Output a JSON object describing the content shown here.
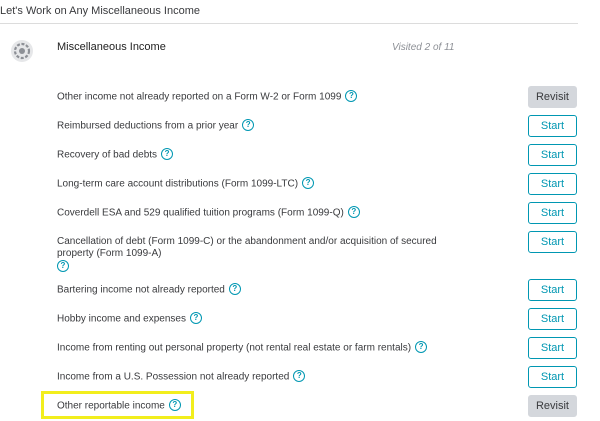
{
  "page": {
    "title": "Let's Work on Any Miscellaneous Income"
  },
  "section": {
    "icon": "gear-icon",
    "name": "Miscellaneous Income",
    "visited": "Visited 2 of 11"
  },
  "help_glyph": "?",
  "items": [
    {
      "label": "Other income not already reported on a Form W-2 or Form 1099",
      "button": "Revisit",
      "state": "revisit"
    },
    {
      "label": "Reimbursed deductions from a prior year",
      "button": "Start",
      "state": "start"
    },
    {
      "label": "Recovery of bad debts",
      "button": "Start",
      "state": "start"
    },
    {
      "label": "Long-term care account distributions (Form 1099-LTC)",
      "button": "Start",
      "state": "start"
    },
    {
      "label": "Coverdell ESA and 529 qualified tuition programs (Form 1099-Q)",
      "button": "Start",
      "state": "start"
    },
    {
      "label": "Cancellation of debt (Form 1099-C) or the abandonment and/or acquisition of secured property (Form 1099-A)",
      "button": "Start",
      "state": "start"
    },
    {
      "label": "Bartering income not already reported",
      "button": "Start",
      "state": "start"
    },
    {
      "label": "Hobby income and expenses",
      "button": "Start",
      "state": "start"
    },
    {
      "label": "Income from renting out personal property (not rental real estate or farm rentals)",
      "button": "Start",
      "state": "start"
    },
    {
      "label": "Income from a U.S. Possession not already reported",
      "button": "Start",
      "state": "start"
    },
    {
      "label": "Other reportable income",
      "button": "Revisit",
      "state": "revisit",
      "highlighted": true
    }
  ],
  "colors": {
    "accent": "#0097b2",
    "highlight": "#f2ee1d",
    "revisit_bg": "#d4d7dc"
  }
}
